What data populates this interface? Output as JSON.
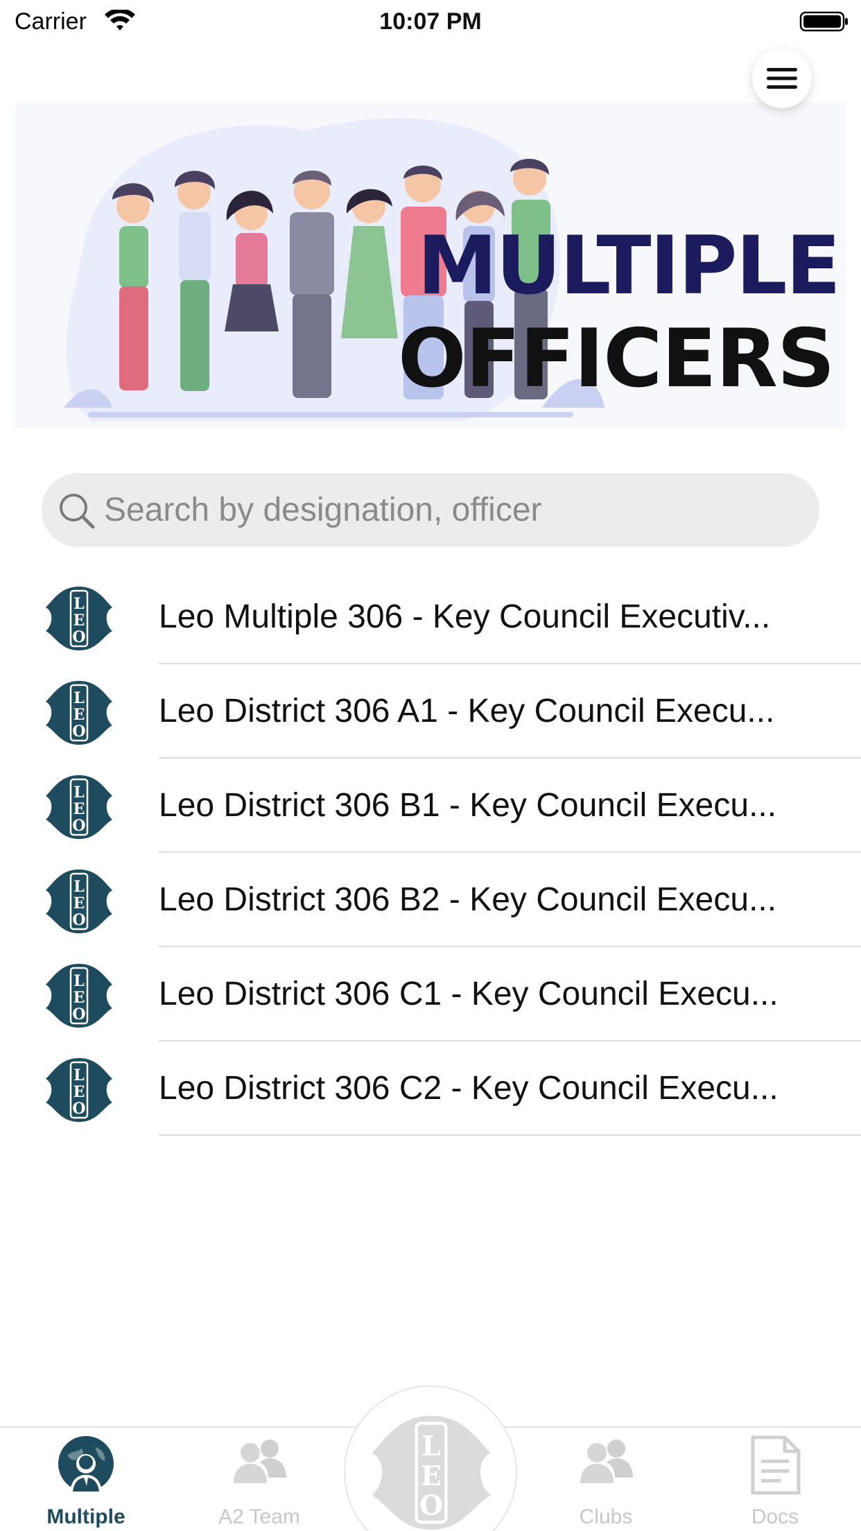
{
  "status_bar": {
    "carrier": "Carrier",
    "time": "10:07 PM"
  },
  "banner": {
    "title_line1": "MULTIPLE",
    "title_line2": "OFFICERS"
  },
  "search": {
    "placeholder": "Search by designation, officer",
    "value": ""
  },
  "list": {
    "items": [
      {
        "label": "Leo Multiple 306 - Key Council Executiv...",
        "icon": "leo-logo-icon"
      },
      {
        "label": "Leo District 306 A1 - Key Council Execu...",
        "icon": "leo-logo-icon"
      },
      {
        "label": "Leo District 306 B1 - Key Council Execu...",
        "icon": "leo-logo-icon"
      },
      {
        "label": "Leo District 306 B2 - Key Council Execu...",
        "icon": "leo-logo-icon"
      },
      {
        "label": "Leo District 306 C1 - Key Council Execu...",
        "icon": "leo-logo-icon"
      },
      {
        "label": "Leo District 306 C2 - Key Council Execu...",
        "icon": "leo-logo-icon"
      }
    ]
  },
  "tabbar": {
    "tabs": [
      {
        "label": "Multiple",
        "icon": "officer-globe-icon",
        "active": true
      },
      {
        "label": "A2 Team",
        "icon": "team-icon",
        "active": false
      },
      {
        "label": "",
        "icon": "leo-logo-icon",
        "active": false
      },
      {
        "label": "Clubs",
        "icon": "clubs-icon",
        "active": false
      },
      {
        "label": "Docs",
        "icon": "document-icon",
        "active": false
      }
    ]
  },
  "colors": {
    "accent": "#1f4b5e",
    "banner_title": "#1c1b5e",
    "inactive_tab": "#c7c7c7"
  }
}
